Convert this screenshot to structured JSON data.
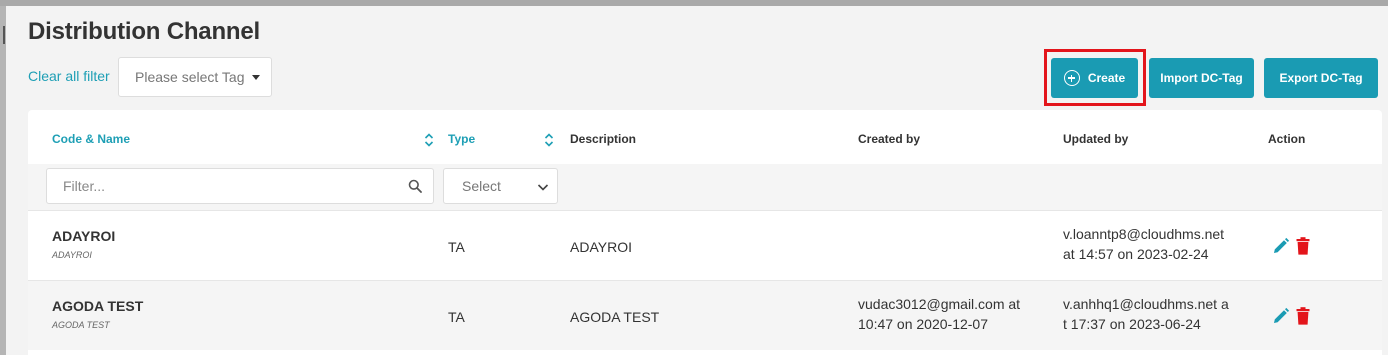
{
  "page": {
    "title": "Distribution Channel"
  },
  "filters": {
    "clear_all_label": "Clear all filter",
    "tag_placeholder": "Please select Tag",
    "code_filter_placeholder": "Filter...",
    "type_filter_placeholder": "Select"
  },
  "toolbar": {
    "create_label": "Create",
    "import_label": "Import DC-Tag",
    "export_label": "Export DC-Tag"
  },
  "table": {
    "columns": {
      "code_name": "Code & Name",
      "type": "Type",
      "description": "Description",
      "created_by": "Created by",
      "updated_by": "Updated by",
      "action": "Action"
    },
    "rows": [
      {
        "code": "ADAYROI",
        "name": "ADAYROI",
        "type": "TA",
        "description": "ADAYROI",
        "created_by_line1": "",
        "created_by_line2": "",
        "updated_by_line1": "v.loanntp8@cloudhms.net",
        "updated_by_line2": "at 14:57 on 2023-02-24"
      },
      {
        "code": "AGODA TEST",
        "name": "AGODA TEST",
        "type": "TA",
        "description": "AGODA TEST",
        "created_by_line1": "vudac3012@gmail.com at",
        "created_by_line2": "10:47 on 2020-12-07",
        "updated_by_line1": "v.anhhq1@cloudhms.net a",
        "updated_by_line2": "t 17:37 on 2023-06-24"
      }
    ]
  },
  "colors": {
    "accent": "#1a9bb3",
    "link": "#1e9fb5",
    "delete": "#e3151b",
    "highlight": "#e3151b"
  },
  "icons": {
    "create": "plus-circle-icon",
    "sort": "sort-icon",
    "search": "search-icon",
    "dropdown": "chevron-down-icon",
    "edit": "pencil-icon",
    "delete": "trash-icon"
  }
}
